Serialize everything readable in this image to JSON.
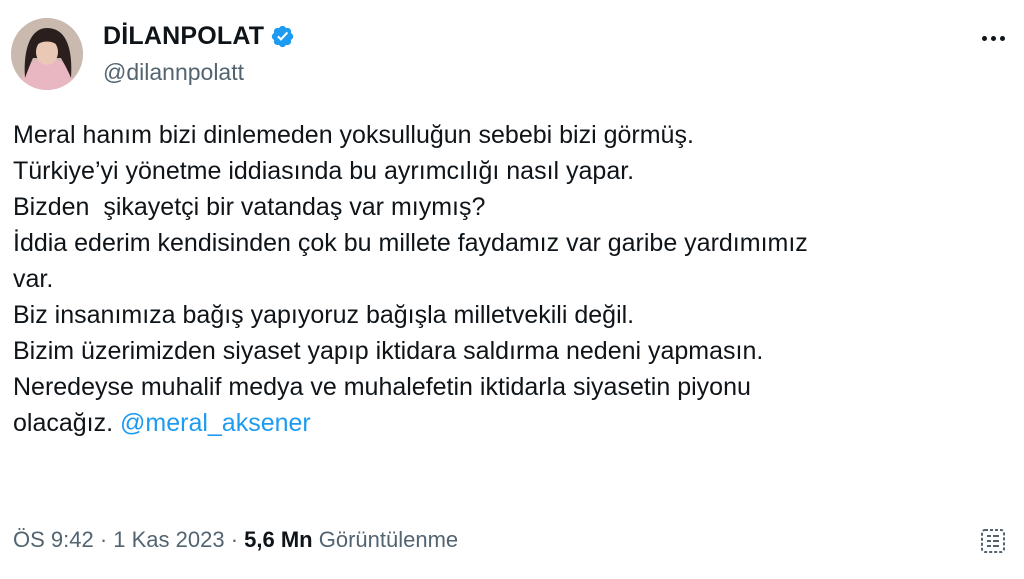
{
  "author": {
    "display_name": "DİLANPOLAT",
    "handle": "@dilannpolatt",
    "verified": true
  },
  "tweet": {
    "lines": [
      "Meral hanım bizi dinlemeden yoksulluğun sebebi bizi görmüş.",
      "Türkiye’yi yönetme iddiasında bu ayrımcılığı nasıl yapar.",
      "Bizden  şikayetçi bir vatandaş var mıymış?",
      "İddia ederim kendisinden çok bu millete faydamız var garibe yardımımız",
      "var.",
      "Biz insanımıza bağış yapıyoruz bağışla milletvekili değil.",
      "Bizim üzerimizden siyaset yapıp iktidara saldırma nedeni yapmasın.",
      "Neredeyse muhalif medya ve muhalefetin iktidarla siyasetin piyonu"
    ],
    "last_line_text": "olacağız. ",
    "mention": "@meral_aksener"
  },
  "meta": {
    "time": "ÖS 9:42",
    "separator": " · ",
    "date": "1 Kas 2023",
    "views_count": "5,6 Mn",
    "views_label": " Görüntülenme"
  },
  "colors": {
    "text": "#0f1419",
    "secondary": "#536471",
    "accent": "#1d9bf0"
  },
  "icons": {
    "verified": "verified-badge-icon",
    "more": "more-options-icon",
    "analytics": "view-analytics-icon"
  }
}
